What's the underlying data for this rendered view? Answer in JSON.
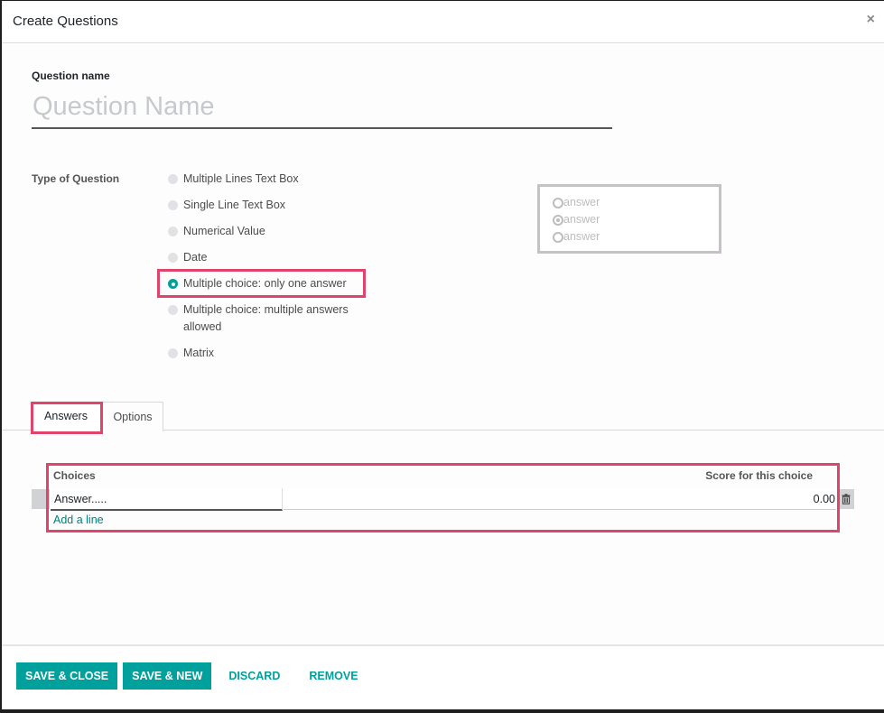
{
  "modal": {
    "title": "Create Questions",
    "close_label": "×"
  },
  "form": {
    "question_name_label": "Question name",
    "question_name_placeholder": "Question Name",
    "question_name_value": "",
    "type_label": "Type of Question",
    "question_types": [
      {
        "label": "Multiple Lines Text Box",
        "checked": false
      },
      {
        "label": "Single Line Text Box",
        "checked": false
      },
      {
        "label": "Numerical Value",
        "checked": false
      },
      {
        "label": "Date",
        "checked": false
      },
      {
        "label": "Multiple choice: only one answer",
        "checked": true
      },
      {
        "label": "Multiple choice: multiple answers allowed",
        "checked": false
      },
      {
        "label": "Matrix",
        "checked": false
      }
    ],
    "preview": {
      "options": [
        "answer",
        "answer",
        "answer"
      ],
      "selected_index": 1
    }
  },
  "tabs": [
    {
      "label": "Answers",
      "active": true
    },
    {
      "label": "Options",
      "active": false
    }
  ],
  "answers_table": {
    "columns": [
      "Choices",
      "Score for this choice"
    ],
    "rows": [
      {
        "choice": "Answer.....",
        "score": "0.00"
      }
    ],
    "add_line_label": "Add a line"
  },
  "footer": {
    "save_close_label": "SAVE & CLOSE",
    "save_new_label": "SAVE & NEW",
    "discard_label": "DISCARD",
    "remove_label": "REMOVE"
  },
  "colors": {
    "primary": "#00a09d",
    "highlight": "#e0446a"
  }
}
